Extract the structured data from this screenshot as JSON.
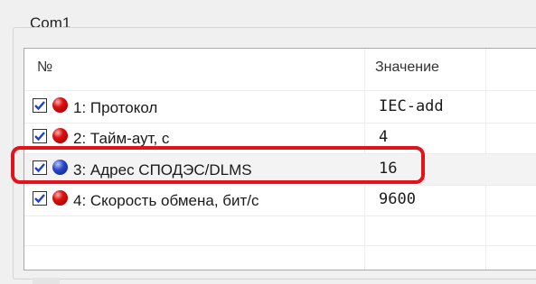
{
  "group": {
    "title": "Com1"
  },
  "table": {
    "headers": {
      "num": "№",
      "value": "Значение"
    },
    "rows": [
      {
        "label": "1: Протокол",
        "value": "IEC-add",
        "checked": true,
        "icon": "red-ball-icon"
      },
      {
        "label": "2: Тайм-аут, с",
        "value": "4",
        "checked": true,
        "icon": "red-ball-icon"
      },
      {
        "label": "3: Адрес СПОДЭС/DLMS",
        "value": "16",
        "checked": true,
        "icon": "blue-ball-icon",
        "selected": true
      },
      {
        "label": "4: Скорость обмена, бит/с",
        "value": "9600",
        "checked": true,
        "icon": "red-ball-icon"
      }
    ]
  },
  "colors": {
    "highlight": "#e0141a",
    "checkbox_check": "#1a3fd1"
  }
}
